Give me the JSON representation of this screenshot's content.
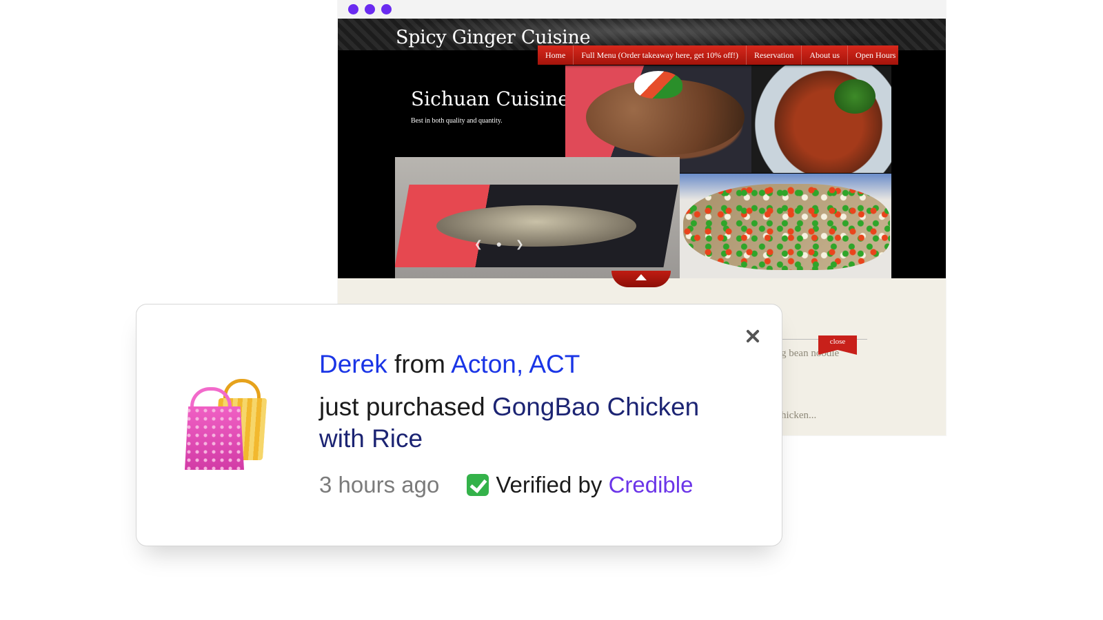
{
  "site": {
    "title": "Spicy Ginger Cuisine",
    "nav": [
      "Home",
      "Full Menu (Order takeaway here, get 10% off!)",
      "Reservation",
      "About us",
      "Open Hours"
    ],
    "hero_title": "Sichuan Cuisine",
    "hero_subtitle": "Best in both quality and quantity.",
    "close_ribbon": "close",
    "peek_text_1": "g bean noodle",
    "peek_text_2": "hicken..."
  },
  "notification": {
    "customer_name": "Derek",
    "from_word": "from",
    "location": "Acton, ACT",
    "action": "just purchased",
    "product": "GongBao Chicken with Rice",
    "time_ago": "3 hours ago",
    "verified_text": "Verified by",
    "verified_brand": "Credible",
    "icon": "shopping-bags-icon"
  },
  "colors": {
    "window_dots": "#6a2bf0",
    "nav_red": "#c8201a",
    "link_blue": "#1a35e6",
    "product_navy": "#1c2473",
    "brand_purple": "#6b35e8"
  }
}
